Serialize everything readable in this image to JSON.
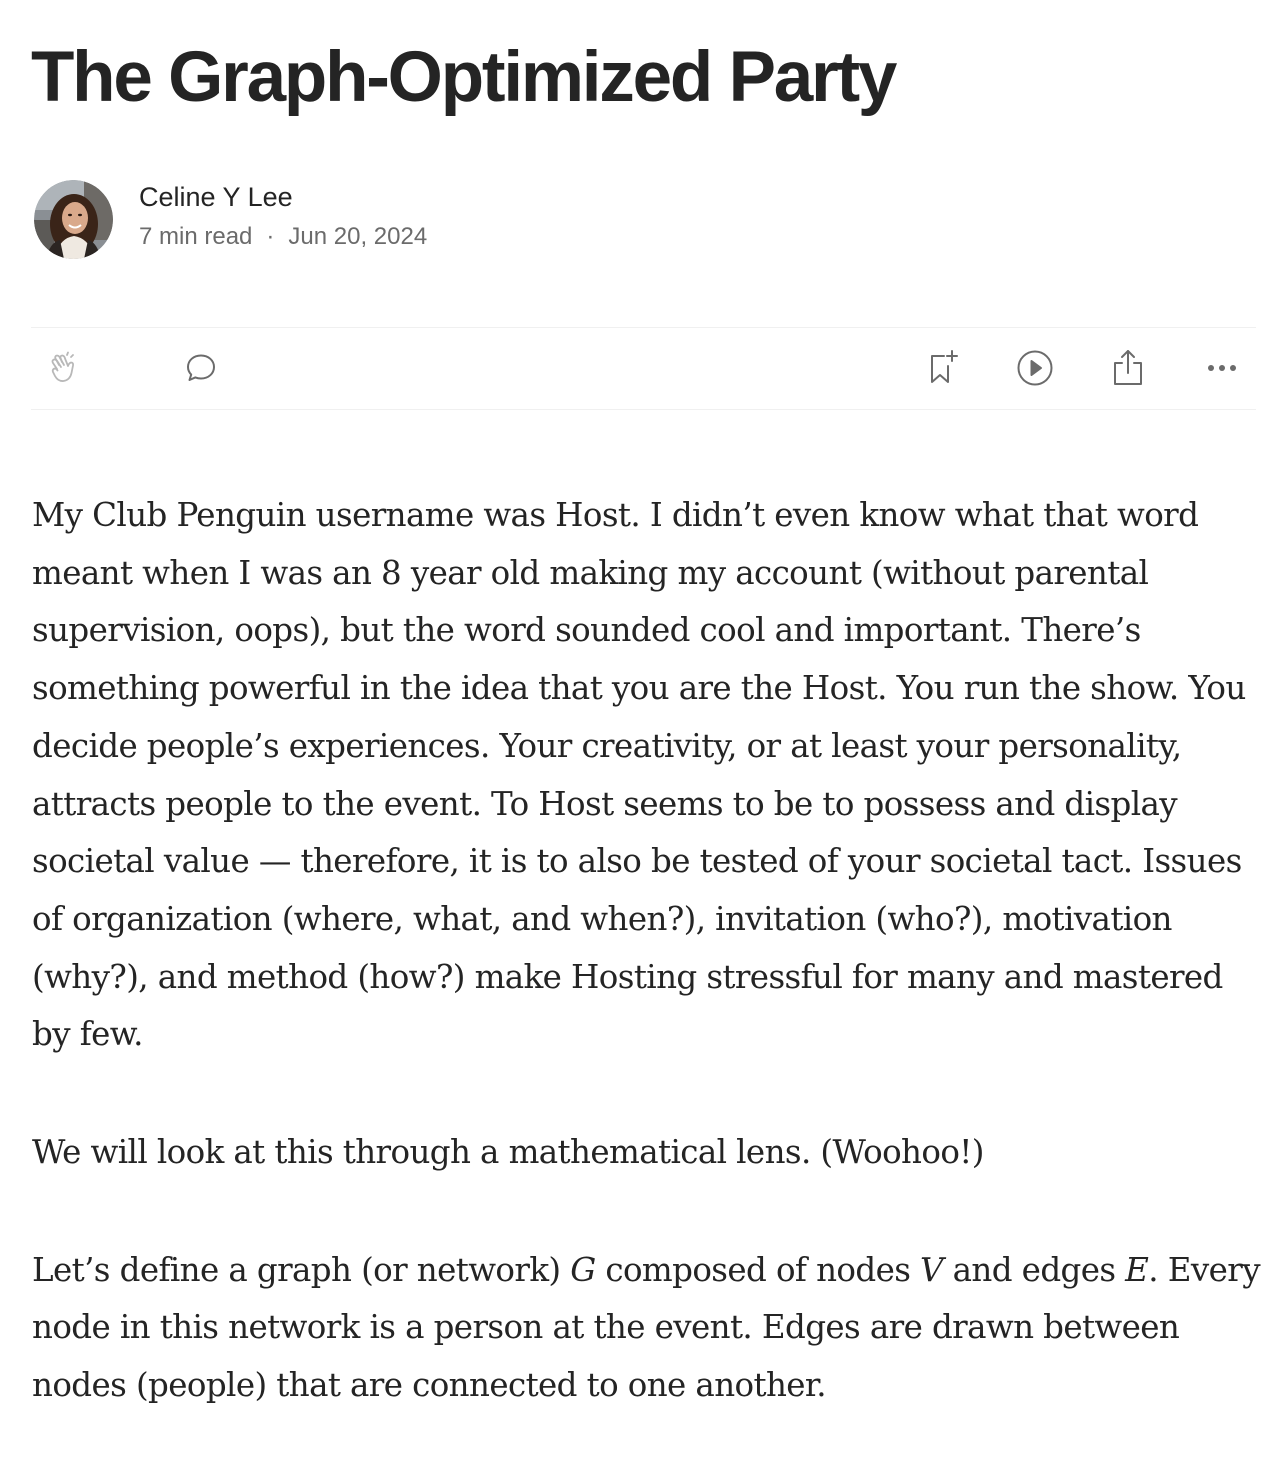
{
  "article": {
    "title": "The Graph-Optimized Party",
    "author": "Celine Y Lee",
    "read_time": "7 min read",
    "separator": "·",
    "date": "Jun 20, 2024"
  },
  "toolbar": {
    "icons": [
      "clap-icon",
      "comment-icon",
      "bookmark-add-icon",
      "play-icon",
      "share-icon",
      "more-icon"
    ]
  },
  "body": {
    "p1": "My Club Penguin username was Host. I didn’t even know what that word meant when I was an 8 year old making my account (without parental supervision, oops), but the word sounded cool and important. There’s something powerful in the idea that you are the Host. You run the show. You decide people’s experiences. Your creativity, or at least your personality, attracts people to the event. To Host seems to be to possess and display societal value — therefore, it is to also be tested of your societal tact. Issues of organization (where, what, and when?), invitation (who?), motivation (why?), and method (how?) make Hosting stressful for many and mastered by few.",
    "p2": "We will look at this through a mathematical lens. (Woohoo!)",
    "p3": {
      "part1": "Let’s define a graph (or network) ",
      "var_g": "G",
      "part2": " composed of nodes ",
      "var_v": "V",
      "part3": " and edges ",
      "var_e": "E",
      "part4": ". Every node in this network is a person at the event. Edges are drawn between nodes (people) that are connected to one another."
    }
  },
  "colors": {
    "text": "#242424",
    "muted": "#6b6b6b",
    "icon": "#6b6b6b",
    "divider": "#f0f0f0"
  }
}
